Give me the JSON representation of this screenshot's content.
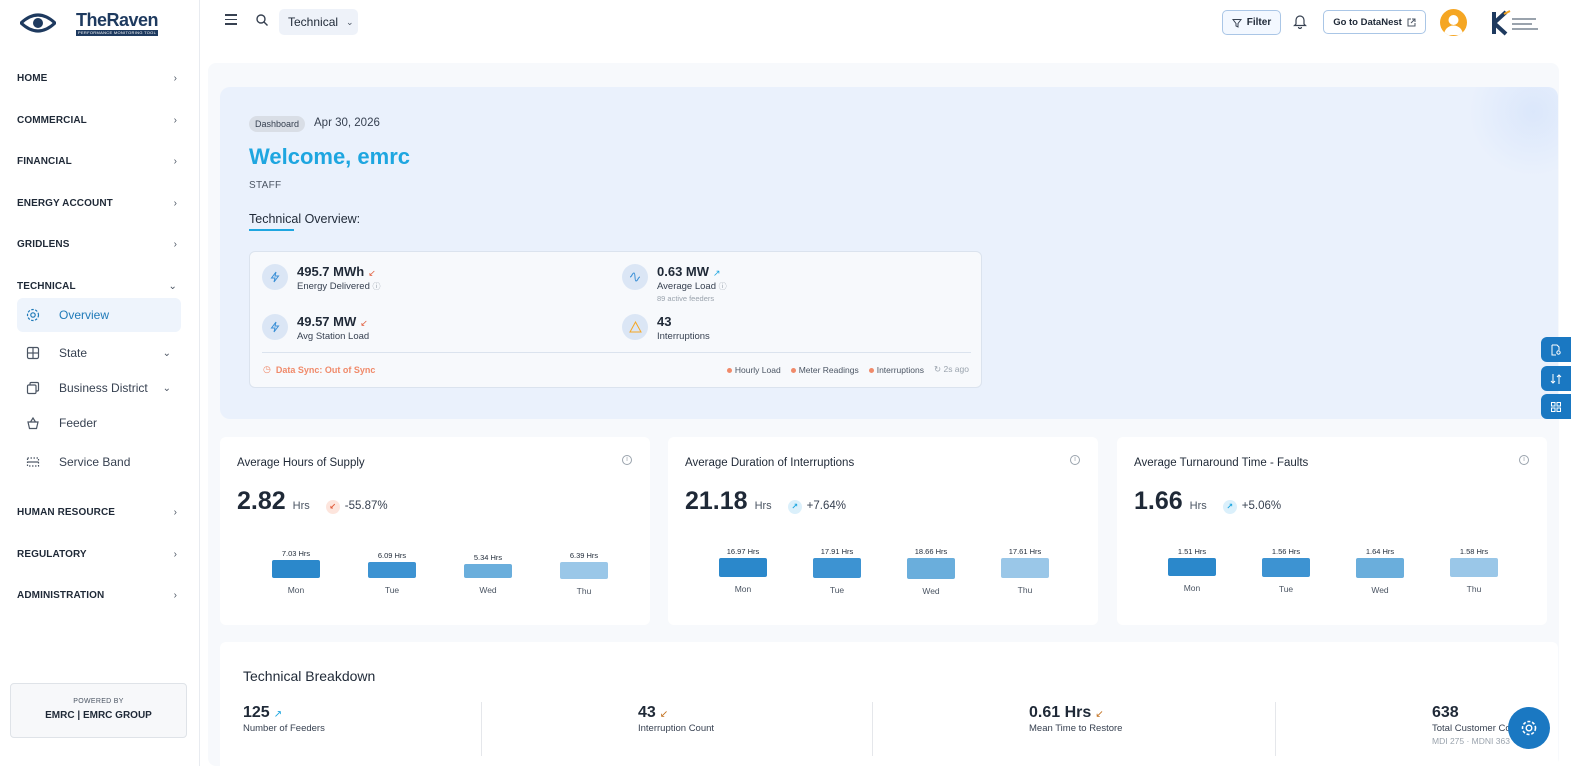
{
  "app": {
    "title": "TheRaven",
    "subtitle": "PERFORMANCE MONITORING TOOL"
  },
  "sidebar": {
    "items": [
      {
        "label": "HOME"
      },
      {
        "label": "COMMERCIAL"
      },
      {
        "label": "FINANCIAL"
      },
      {
        "label": "ENERGY ACCOUNT"
      },
      {
        "label": "GRIDLENS"
      },
      {
        "label": "TECHNICAL"
      },
      {
        "label": "HUMAN RESOURCE"
      },
      {
        "label": "REGULATORY"
      },
      {
        "label": "ADMINISTRATION"
      }
    ],
    "technical_sub": [
      {
        "label": "Overview",
        "icon": "gear-icon"
      },
      {
        "label": "State",
        "icon": "grid-icon"
      },
      {
        "label": "Business District",
        "icon": "copy-icon"
      },
      {
        "label": "Feeder",
        "icon": "basket-icon"
      },
      {
        "label": "Service Band",
        "icon": "band-icon"
      }
    ],
    "powered_label": "POWERED BY",
    "powered_brand": "EMRC | EMRC GROUP"
  },
  "topbar": {
    "module": "Technical",
    "filter_label": "Filter",
    "datanest_label": "Go to DataNest"
  },
  "hero": {
    "crumb": "Dashboard",
    "date": "Apr 30, 2026",
    "welcome": "Welcome, emrc",
    "role": "STAFF",
    "overview_title": "Technical Overview:",
    "kpis": {
      "energy": {
        "value": "495.7 MWh",
        "label": "Energy Delivered"
      },
      "load": {
        "value": "0.63 MW",
        "label": "Average Load",
        "sub": "89 active feeders"
      },
      "station": {
        "value": "49.57 MW",
        "label": "Avg Station Load"
      },
      "interruptions": {
        "value": "43",
        "label": "Interruptions"
      }
    },
    "sync": "Data Sync: Out of Sync",
    "legend": [
      "Hourly Load",
      "Meter Readings",
      "Interruptions"
    ],
    "ago": "2s ago"
  },
  "cards": [
    {
      "title": "Average Hours of Supply",
      "value": "2.82",
      "unit": "Hrs",
      "change": "-55.87%",
      "trend": "down",
      "bars": [
        {
          "label": "7.03 Hrs",
          "day": "Mon"
        },
        {
          "label": "6.09 Hrs",
          "day": "Tue"
        },
        {
          "label": "5.34 Hrs",
          "day": "Wed"
        },
        {
          "label": "6.39 Hrs",
          "day": "Thu"
        }
      ]
    },
    {
      "title": "Average Duration of Interruptions",
      "value": "21.18",
      "unit": "Hrs",
      "change": "+7.64%",
      "trend": "up",
      "bars": [
        {
          "label": "16.97 Hrs",
          "day": "Mon"
        },
        {
          "label": "17.91 Hrs",
          "day": "Tue"
        },
        {
          "label": "18.66 Hrs",
          "day": "Wed"
        },
        {
          "label": "17.61 Hrs",
          "day": "Thu"
        }
      ]
    },
    {
      "title": "Average Turnaround Time - Faults",
      "value": "1.66",
      "unit": "Hrs",
      "change": "+5.06%",
      "trend": "up",
      "bars": [
        {
          "label": "1.51 Hrs",
          "day": "Mon"
        },
        {
          "label": "1.56 Hrs",
          "day": "Tue"
        },
        {
          "label": "1.64 Hrs",
          "day": "Wed"
        },
        {
          "label": "1.58 Hrs",
          "day": "Thu"
        }
      ]
    }
  ],
  "bar_colors": [
    "#2b88cb",
    "#3d93d2",
    "#6aaedc",
    "#9ac7e8"
  ],
  "breakdown": {
    "title": "Technical Breakdown",
    "items": [
      {
        "value": "125",
        "label": "Number of Feeders",
        "trend": "up"
      },
      {
        "value": "43",
        "label": "Interruption Count",
        "trend": "down"
      },
      {
        "value": "0.61 Hrs",
        "label": "Mean Time to Restore",
        "trend": "down"
      },
      {
        "value": "638",
        "label": "Total Customer Co",
        "sub": "MDI 275 · MDNI 363"
      }
    ]
  }
}
